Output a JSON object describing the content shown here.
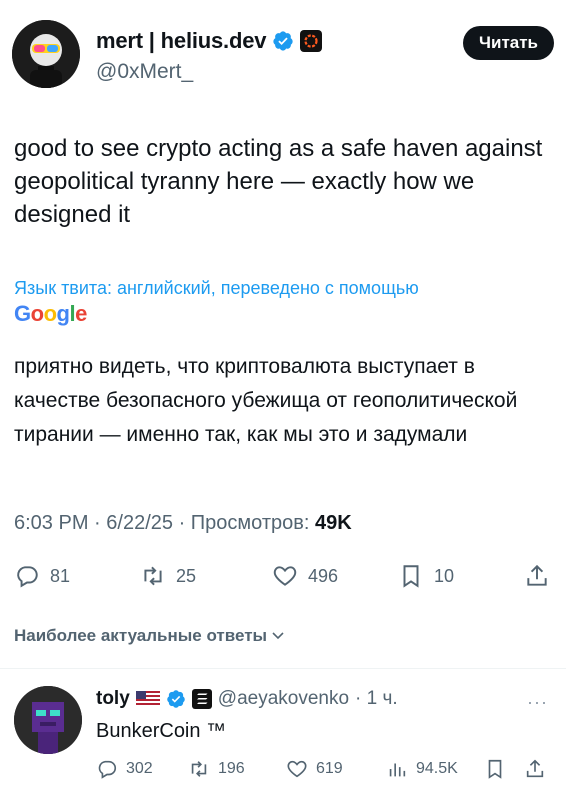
{
  "author": {
    "name": "mert | helius.dev",
    "handle": "@0xMert_",
    "follow_label": "Читать"
  },
  "tweet": {
    "text": "good to see crypto acting as a safe haven against geopolitical tyranny here — exactly how we designed it",
    "translation_note": "Язык твита: английский, переведено с помощью",
    "translation_provider": "Google",
    "translation": "приятно видеть, что криптовалюта выступает в качестве безопасного убежища от геополитической тирании — именно так, как мы это и задумали",
    "time": "6:03 PM",
    "date": "6/22/25",
    "views_label": "Просмотров:",
    "views_value": "49K"
  },
  "actions": {
    "replies": "81",
    "retweets": "25",
    "likes": "496",
    "bookmarks": "10"
  },
  "replies_sort_label": "Наиболее актуальные ответы",
  "reply": {
    "name": "toly",
    "handle": "@aeyakovenko",
    "time": "· 1 ч.",
    "text": "BunkerCoin ™",
    "replies": "302",
    "retweets": "196",
    "likes": "619",
    "views": "94.5K"
  },
  "colors": {
    "accent": "#1d9bf0",
    "text": "#0f1419",
    "muted": "#536471",
    "button": "#0f1419"
  }
}
